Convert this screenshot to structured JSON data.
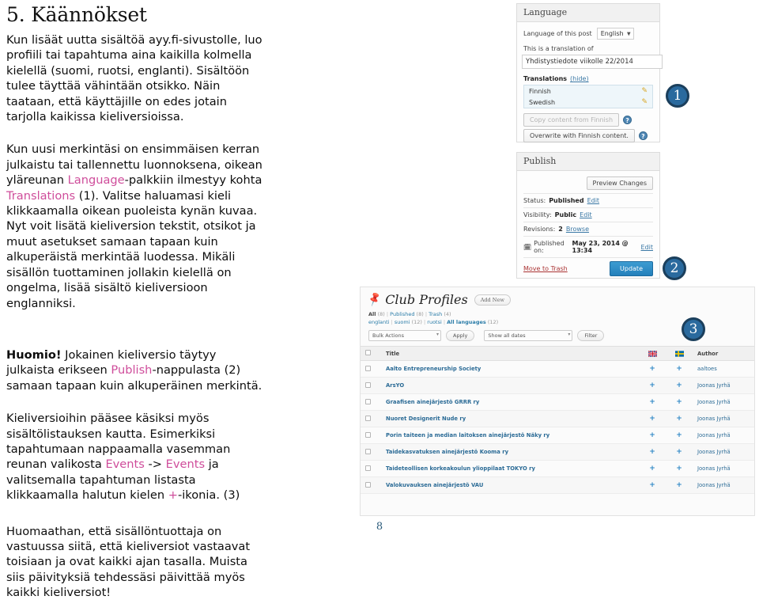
{
  "document": {
    "heading": "5. Käännökset",
    "page_number": "8"
  },
  "paragraphs": {
    "p1": "Kun lisäät uutta sisältöä ayy.fi-sivustolle, luo profiili tai tapahtuma aina kaikilla kolmella kielellä (suomi, ruotsi, englanti). Sisältöön tulee täyttää vähintään otsikko. Näin taataan, että käyttäjille on edes jotain tarjolla kaikissa kieliversioissa.",
    "p2_a": "Kun uusi merkintäsi on ensimmäisen kerran julkaistu tai tallennettu luonnoksena, oikean yläreunan ",
    "p2_hl1": "Language",
    "p2_b": "-palkkiin ilmestyy kohta ",
    "p2_hl2": "Translations",
    "p2_c": " (1). Valitse haluamasi kieli klikkaamalla oikean puoleista kynän kuvaa. Nyt voit lisätä kieliversion tekstit, otsikot ja muut asetukset samaan tapaan kuin alkuperäistä merkintää luodessa. Mikäli sisällön tuottaminen jollakin kielellä on ongelma, lisää sisältö kieliversioon englanniksi.",
    "p3_bold": "Huomio!",
    "p3_a": " Jokainen kieliversio täytyy julkaista erikseen ",
    "p3_hl": "Publish",
    "p3_b": "-nappulasta (2) samaan tapaan kuin alkuperäinen merkintä.",
    "p4_a": "Kieliversioihin pääsee käsiksi myös sisältölistauksen kautta. Esimerkiksi tapahtumaan nappaamalla vasemman reunan valikosta ",
    "p4_hl1": "Events",
    "p4_b": " -> ",
    "p4_hl2": "Events",
    "p4_c": " ja valitsemalla tapahtuman listasta klikkaamalla halutun kielen ",
    "p4_hl3": "+",
    "p4_d": "-ikonia. (3)",
    "p5": "Huomaathan, että sisällöntuottaja on vastuussa siitä, että kieliversiot vastaavat toisiaan ja ovat kaikki ajan tasalla. Muista siis päivityksiä tehdessäsi päivittää myös kaikki kieliversiot!"
  },
  "badges": {
    "one": "1",
    "two": "2",
    "three": "3"
  },
  "language_panel": {
    "title": "Language",
    "language_of_post_label": "Language of this post",
    "language_select_value": "English",
    "translation_of_label": "This is a translation of",
    "translation_of_value": "Yhdistystiedote viikolle 22/2014",
    "translations_label": "Translations",
    "hide_link": "(hide)",
    "translations": [
      {
        "language": "Finnish",
        "edit_icon": "pencil-icon"
      },
      {
        "language": "Swedish",
        "edit_icon": "pencil-icon"
      }
    ],
    "copy_button": "Copy content from Finnish",
    "overwrite_button": "Overwrite with Finnish content.",
    "help_glyph": "?"
  },
  "publish_panel": {
    "title": "Publish",
    "preview_button": "Preview Changes",
    "status_label": "Status:",
    "status_value": "Published",
    "status_edit": "Edit",
    "visibility_label": "Visibility:",
    "visibility_value": "Public",
    "visibility_edit": "Edit",
    "revisions_label": "Revisions:",
    "revisions_value": "2",
    "revisions_browse": "Browse",
    "published_on_label": "Published on:",
    "published_on_value": "May 23, 2014 @ 13:34",
    "published_edit": "Edit",
    "trash_link": "Move to Trash",
    "update_button": "Update"
  },
  "club_profiles": {
    "title": "Club Profiles",
    "add_new": "Add New",
    "status_filters": [
      {
        "label": "All",
        "count": "(8)",
        "current": true
      },
      {
        "label": "Published",
        "count": "(8)",
        "current": false
      },
      {
        "label": "Trash",
        "count": "(4)",
        "current": false
      }
    ],
    "language_filters": [
      {
        "label": "englanti",
        "count": "",
        "current": false
      },
      {
        "label": "suomi",
        "count": "(12)",
        "current": false
      },
      {
        "label": "ruotsi",
        "count": "",
        "current": false
      },
      {
        "label": "All languages",
        "count": "(12)",
        "current": true
      }
    ],
    "bulk_actions_value": "Bulk Actions",
    "apply_button": "Apply",
    "dates_value": "Show all dates",
    "filter_button": "Filter",
    "columns": {
      "title": "Title",
      "flag_en": "uk-flag-icon",
      "flag_sv": "sweden-flag-icon",
      "author": "Author"
    },
    "rows": [
      {
        "title": "Aalto Entrepreneurship Society",
        "author": "aaltoes"
      },
      {
        "title": "ArsYO",
        "author": "Joonas Jyrhä"
      },
      {
        "title": "Graafisen ainejärjestö GRRR ry",
        "author": "Joonas Jyrhä"
      },
      {
        "title": "Nuoret Designerit Nude ry",
        "author": "Joonas Jyrhä"
      },
      {
        "title": "Porin taiteen ja median laitoksen ainejärjestö Näky ry",
        "author": "Joonas Jyrhä"
      },
      {
        "title": "Taidekasvatuksen ainejärjestö Kooma ry",
        "author": "Joonas Jyrhä"
      },
      {
        "title": "Taideteollisen korkeakoulun ylioppilaat TOKYO ry",
        "author": "Joonas Jyrhä"
      },
      {
        "title": "Valokuvauksen ainejärjestö VAU",
        "author": "Joonas Jyrhä"
      }
    ],
    "plus_icon": "+"
  },
  "colors": {
    "accent_pink": "#cf4d9b",
    "link_blue": "#2b6b96",
    "badge_blue": "#2a6a9e",
    "button_blue": "#2480bb"
  }
}
